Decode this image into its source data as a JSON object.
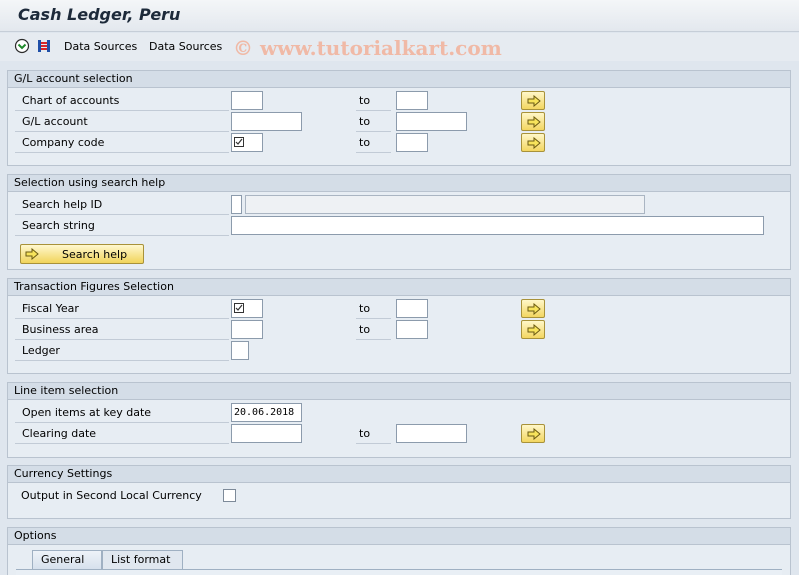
{
  "window": {
    "title": "Cash Ledger, Peru"
  },
  "toolbar": {
    "data_sources_1": "Data Sources",
    "data_sources_2": "Data Sources"
  },
  "watermark": "© www.tutorialkart.com",
  "gl_selection": {
    "title": "G/L account selection",
    "chart_of_accounts": "Chart of accounts",
    "gl_account": "G/L account",
    "company_code": "Company code",
    "to": "to"
  },
  "search_help": {
    "title": "Selection using search help",
    "search_help_id": "Search help ID",
    "search_string": "Search string",
    "button": "Search help"
  },
  "transaction_figures": {
    "title": "Transaction Figures Selection",
    "fiscal_year": "Fiscal Year",
    "business_area": "Business area",
    "ledger": "Ledger",
    "to": "to"
  },
  "line_item": {
    "title": "Line item selection",
    "open_items": "Open items at key date",
    "open_items_value": "20.06.2018",
    "clearing_date": "Clearing date",
    "to": "to"
  },
  "currency": {
    "title": "Currency Settings",
    "output_second": "Output in Second Local Currency"
  },
  "options": {
    "title": "Options",
    "tab_general": "General",
    "tab_list_format": "List format"
  }
}
